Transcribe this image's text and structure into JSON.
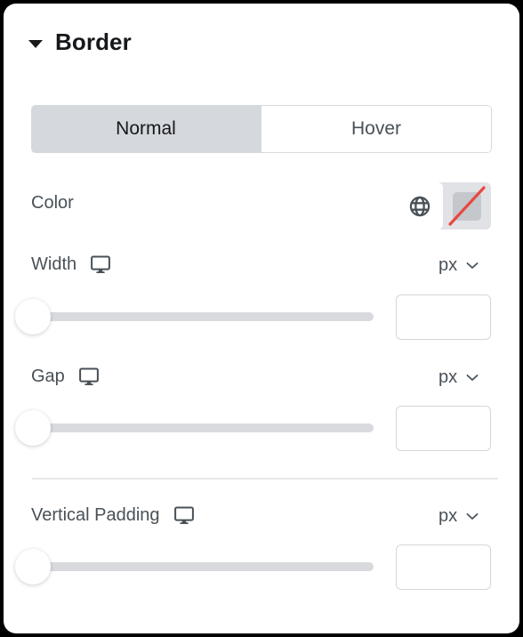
{
  "panel": {
    "section": {
      "title": "Border",
      "caret_icon": "caret-down-icon",
      "expanded": true
    },
    "state_tabs": [
      {
        "label": "Normal",
        "active": true
      },
      {
        "label": "Hover",
        "active": false
      }
    ],
    "controls": [
      {
        "label": "Color",
        "type": "color",
        "globe_icon": "globe-icon",
        "swatch_icon": "no-color-swatch-icon",
        "swatch_color": "#c4c7cc",
        "slash_color": "#e8493f",
        "value": ""
      },
      {
        "label": "Width",
        "type": "slider",
        "device_icon": "desktop-monitor-icon",
        "unit": "px",
        "unit_chevron_icon": "chevron-down-icon",
        "slider_value": 0,
        "slider_min": 0,
        "slider_max": 100,
        "input_value": "",
        "input_placeholder": ""
      },
      {
        "label": "Gap",
        "type": "slider",
        "device_icon": "desktop-monitor-icon",
        "unit": "px",
        "unit_chevron_icon": "chevron-down-icon",
        "slider_value": 0,
        "slider_min": 0,
        "slider_max": 100,
        "input_value": "",
        "input_placeholder": ""
      },
      {
        "label": "Vertical Padding",
        "type": "slider",
        "device_icon": "desktop-monitor-icon",
        "unit": "px",
        "unit_chevron_icon": "chevron-down-icon",
        "slider_value": 0,
        "slider_min": 0,
        "slider_max": 100,
        "input_value": "",
        "input_placeholder": ""
      }
    ],
    "colors": {
      "panel_bg": "#ffffff",
      "outer_bg": "#000000",
      "tab_active_bg": "#d5d8dc",
      "tab_inactive_border": "#d8dade",
      "label_text": "#495157",
      "title_text": "#16181c",
      "track": "#d8dade",
      "thumb": "#ffffff",
      "divider": "#e6e8ea",
      "input_border": "#d3d6da"
    }
  }
}
